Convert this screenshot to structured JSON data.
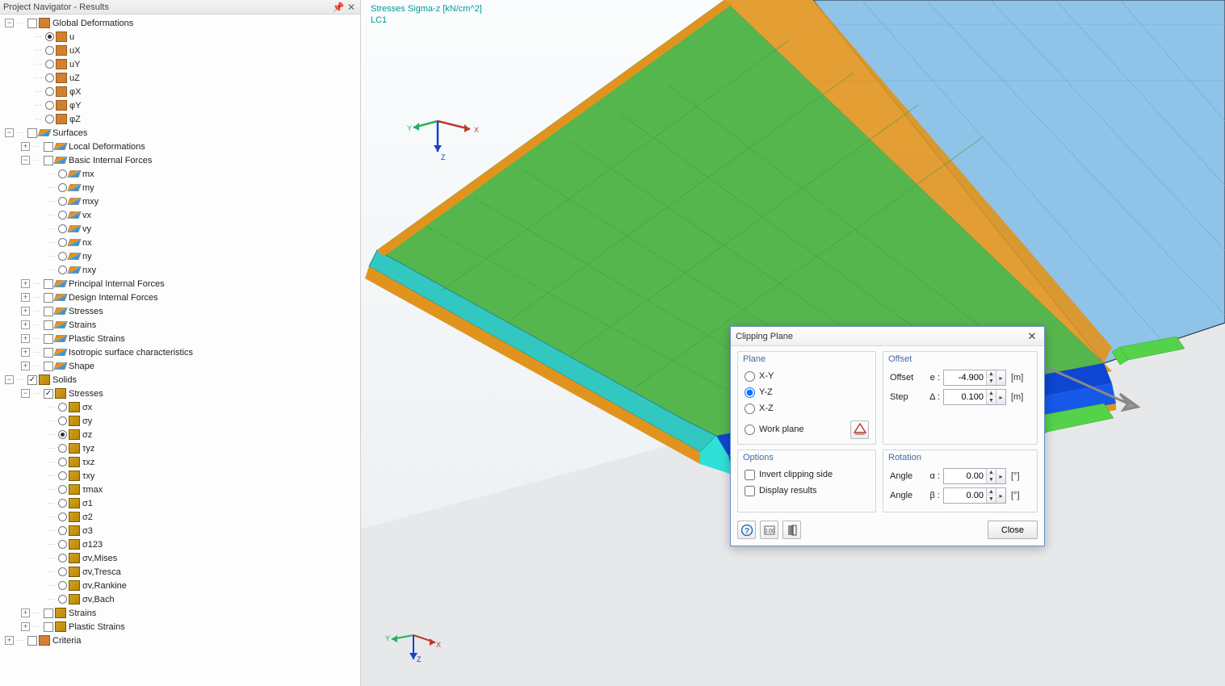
{
  "navigator": {
    "title": "Project Navigator - Results",
    "tree": {
      "global_deformations": {
        "label": "Global Deformations",
        "checked": false,
        "children": {
          "u": {
            "label": "u",
            "selected": true
          },
          "ux": {
            "label": "uX",
            "selected": false
          },
          "uy": {
            "label": "uY",
            "selected": false
          },
          "uz": {
            "label": "uZ",
            "selected": false
          },
          "phx": {
            "label": "φX",
            "selected": false
          },
          "phy": {
            "label": "φY",
            "selected": false
          },
          "phz": {
            "label": "φZ",
            "selected": false
          }
        }
      },
      "surfaces": {
        "label": "Surfaces",
        "checked": false,
        "children": {
          "local_deformations": {
            "label": "Local Deformations",
            "checked": false
          },
          "basic_internal_forces": {
            "label": "Basic Internal Forces",
            "checked": false,
            "children": {
              "mx": {
                "label": "mx",
                "selected": false
              },
              "my": {
                "label": "my",
                "selected": false
              },
              "mxy": {
                "label": "mxy",
                "selected": false
              },
              "vx": {
                "label": "vx",
                "selected": false
              },
              "vy": {
                "label": "vy",
                "selected": false
              },
              "nx": {
                "label": "nx",
                "selected": false
              },
              "ny": {
                "label": "ny",
                "selected": false
              },
              "nxy": {
                "label": "nxy",
                "selected": false
              }
            }
          },
          "principal_internal_forces": {
            "label": "Principal Internal Forces",
            "checked": false
          },
          "design_internal_forces": {
            "label": "Design Internal Forces",
            "checked": false
          },
          "stresses": {
            "label": "Stresses",
            "checked": false
          },
          "strains": {
            "label": "Strains",
            "checked": false
          },
          "plastic_strains": {
            "label": "Plastic Strains",
            "checked": false
          },
          "isotropic_surface": {
            "label": "Isotropic surface characteristics",
            "checked": false
          },
          "shape": {
            "label": "Shape",
            "checked": false
          }
        }
      },
      "solids": {
        "label": "Solids",
        "checked": true,
        "children": {
          "stresses": {
            "label": "Stresses",
            "checked": true,
            "children": {
              "sx": {
                "label": "σx",
                "selected": false
              },
              "sy": {
                "label": "σy",
                "selected": false
              },
              "sz": {
                "label": "σz",
                "selected": true
              },
              "tyz": {
                "label": "τyz",
                "selected": false
              },
              "txz": {
                "label": "τxz",
                "selected": false
              },
              "txy": {
                "label": "τxy",
                "selected": false
              },
              "tmax": {
                "label": "τmax",
                "selected": false
              },
              "s1": {
                "label": "σ1",
                "selected": false
              },
              "s2": {
                "label": "σ2",
                "selected": false
              },
              "s3": {
                "label": "σ3",
                "selected": false
              },
              "s123": {
                "label": "σ123",
                "selected": false
              },
              "svmises": {
                "label": "σv,Mises",
                "selected": false
              },
              "svtresca": {
                "label": "σv,Tresca",
                "selected": false
              },
              "svrankine": {
                "label": "σv,Rankine",
                "selected": false
              },
              "svbach": {
                "label": "σv,Bach",
                "selected": false
              }
            }
          },
          "strains": {
            "label": "Strains",
            "checked": false
          },
          "plastic_strains": {
            "label": "Plastic Strains",
            "checked": false
          }
        }
      },
      "criteria": {
        "label": "Criteria",
        "checked": false
      }
    }
  },
  "viewport": {
    "overlay_line1": "Stresses Sigma-z [kN/cm^2]",
    "overlay_line2": "LC1",
    "axes": {
      "x": "X",
      "y": "Y",
      "z": "Z"
    }
  },
  "dialog": {
    "title": "Clipping Plane",
    "groups": {
      "plane": "Plane",
      "offset": "Offset",
      "options": "Options",
      "rotation": "Rotation"
    },
    "plane": {
      "xy": "X-Y",
      "yz": "Y-Z",
      "xz": "X-Z",
      "work": "Work plane",
      "selected": "yz"
    },
    "offset": {
      "offset_label": "Offset",
      "offset_sym": "e :",
      "offset_val": "-4.900",
      "step_label": "Step",
      "step_sym": "Δ :",
      "step_val": "0.100",
      "unit": "[m]"
    },
    "options": {
      "invert": {
        "label": "Invert clipping side",
        "checked": false
      },
      "display": {
        "label": "Display results",
        "checked": false
      }
    },
    "rotation": {
      "angle_label": "Angle",
      "alpha_sym": "α :",
      "alpha_val": "0.00",
      "beta_sym": "β :",
      "beta_val": "0.00",
      "unit": "[°]"
    },
    "close": "Close"
  }
}
